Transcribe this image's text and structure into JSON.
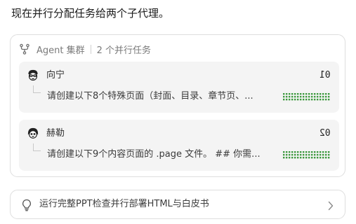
{
  "message": {
    "intro": "现在并行分配任务给两个子代理。"
  },
  "swarm": {
    "icon": "git-fork-icon",
    "title": "Agent 集群",
    "task_count_label": "2 个并行任务",
    "agents": [
      {
        "name": "向宁",
        "number": "01",
        "avatar_icon": "agent-avatar-icon",
        "task": "请创建以下8个特殊页面（封面、目录、章节页、...",
        "progress_color": "#3f9a41"
      },
      {
        "name": "赫勒",
        "number": "02",
        "avatar_icon": "agent-avatar-icon",
        "task": "请创建以下9个内容页面的 .page 文件。 ## 你需...",
        "progress_color": "#3f9a41"
      }
    ]
  },
  "action": {
    "icon": "lightbulb-icon",
    "label": "运行完整PPT检查并行部署HTML与白皮书",
    "chevron_icon": "chevron-right-icon"
  }
}
